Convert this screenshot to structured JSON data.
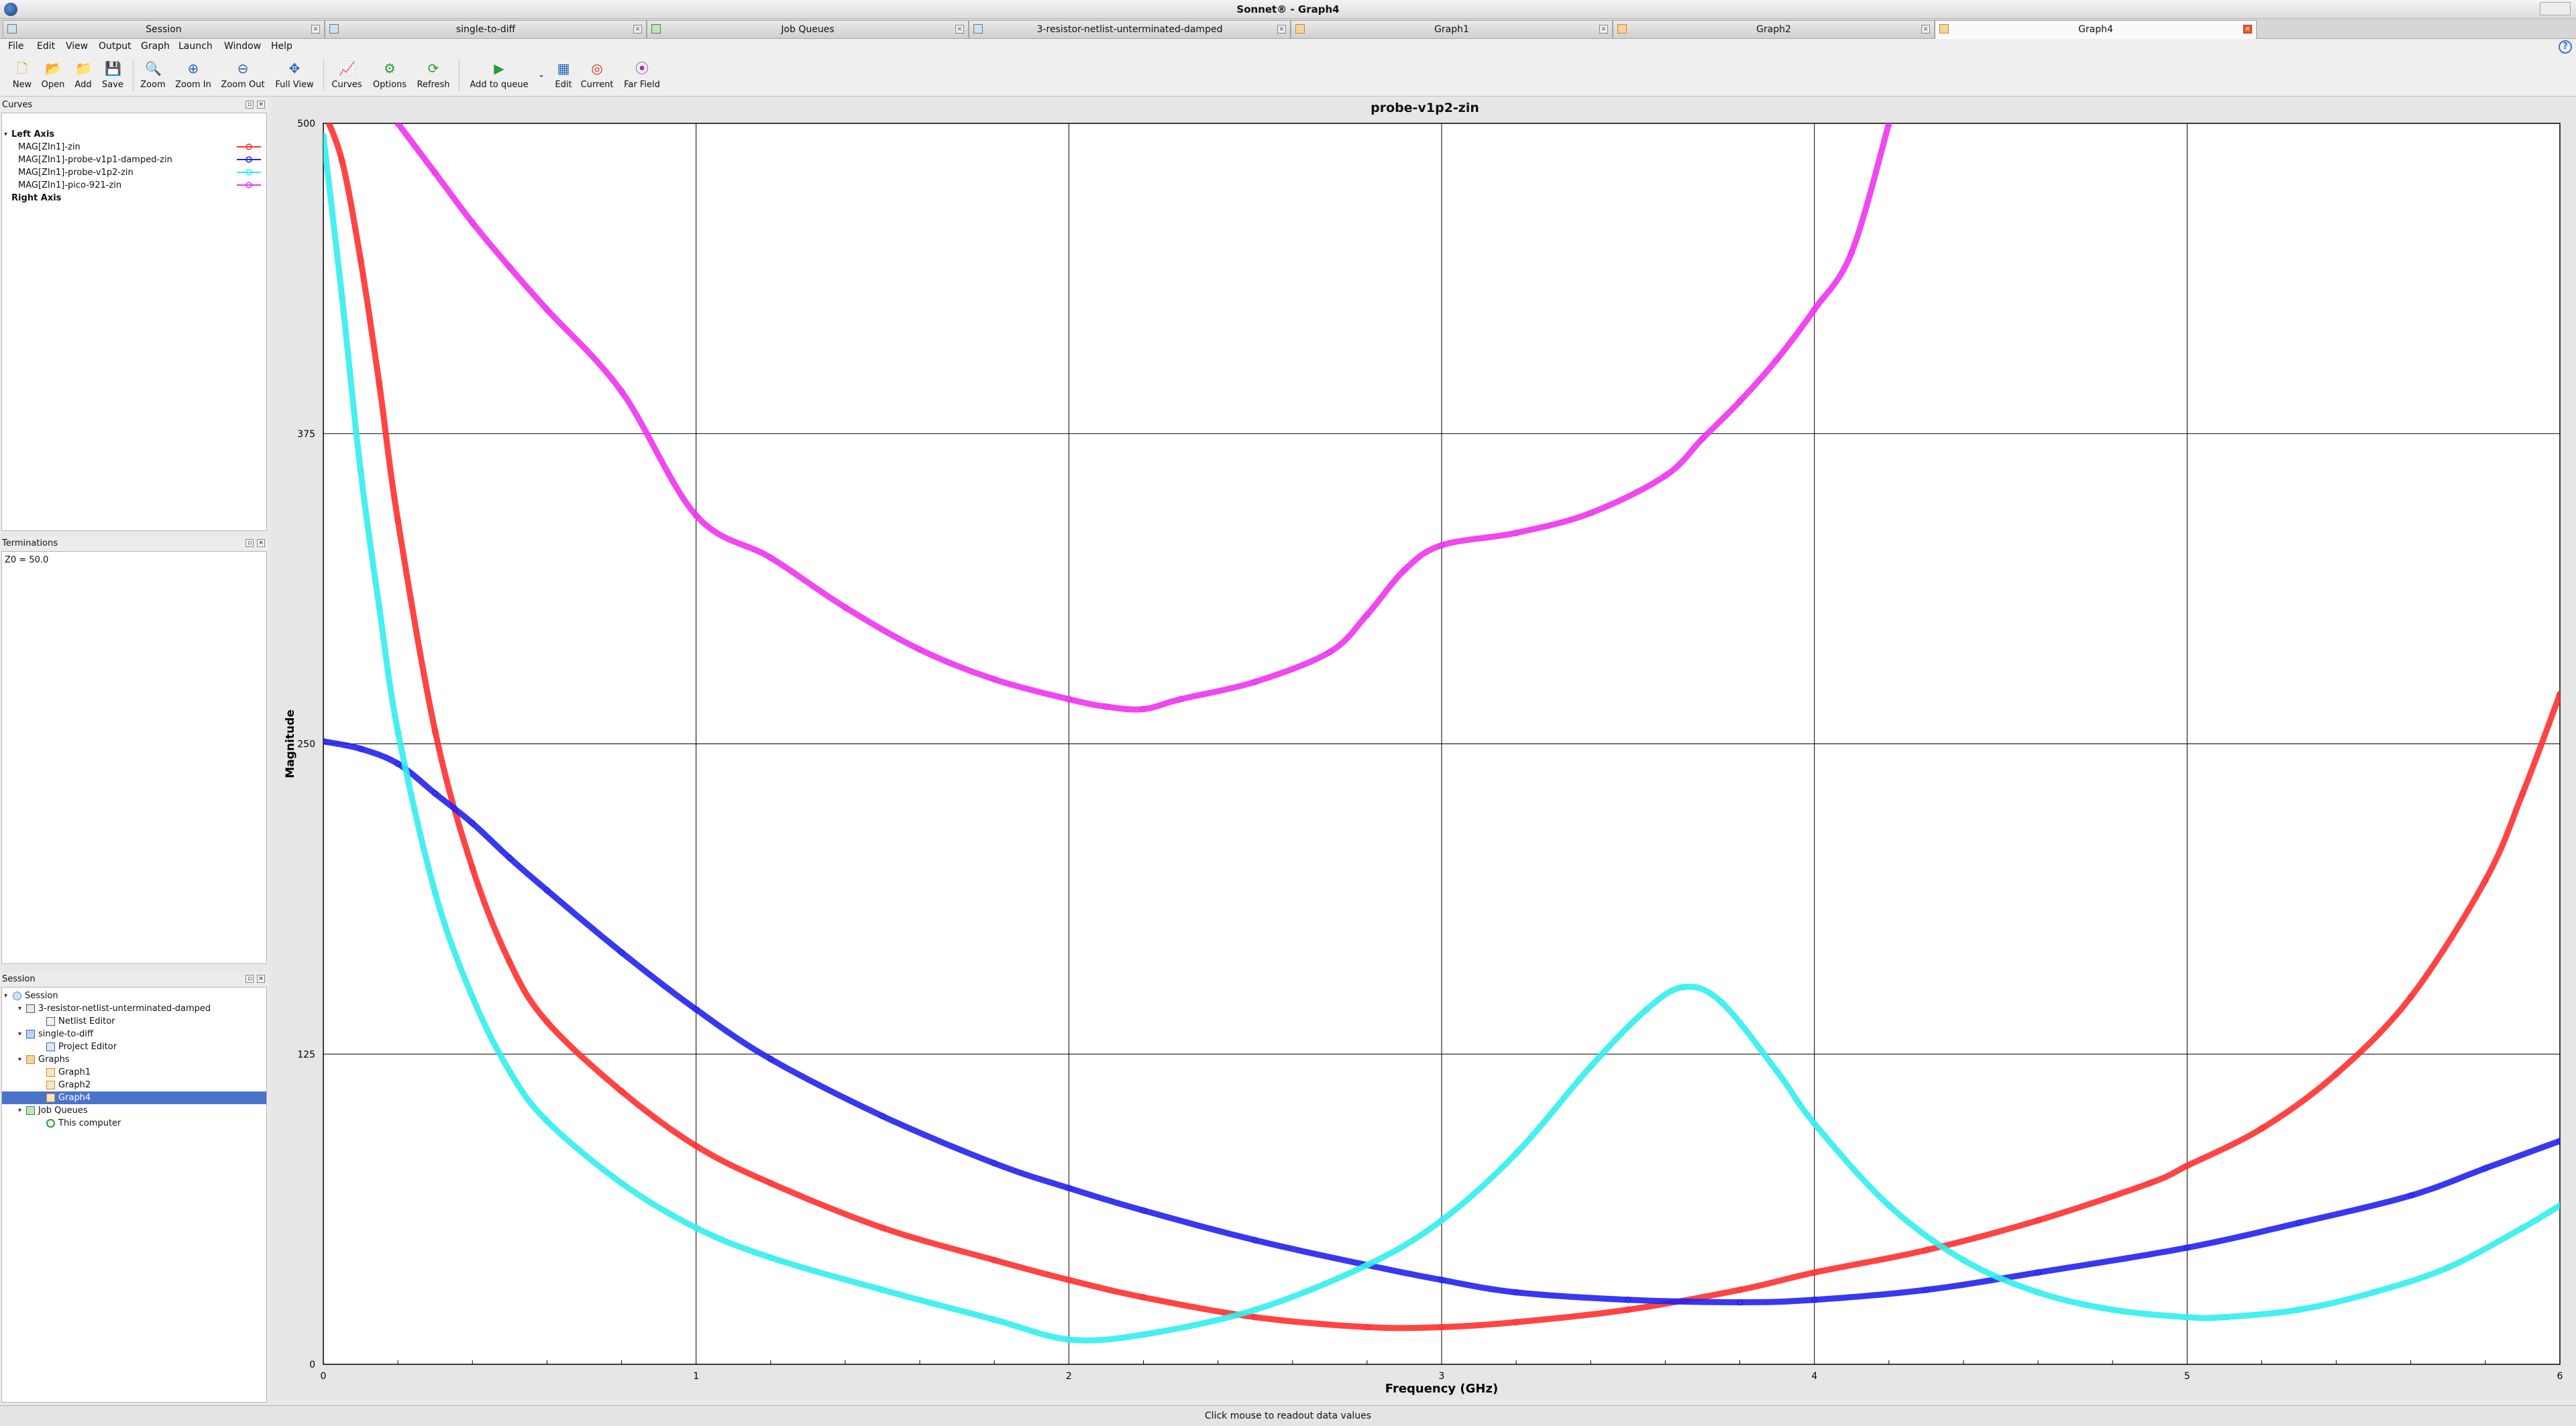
{
  "window": {
    "title": "Sonnet® - Graph4"
  },
  "tabs": [
    {
      "label": "Session",
      "icon": "session-icon"
    },
    {
      "label": "single-to-diff",
      "icon": "project-icon"
    },
    {
      "label": "Job Queues",
      "icon": "job-queue-icon"
    },
    {
      "label": "3-resistor-netlist-unterminated-damped",
      "icon": "netlist-icon"
    },
    {
      "label": "Graph1",
      "icon": "graph-icon"
    },
    {
      "label": "Graph2",
      "icon": "graph-icon"
    },
    {
      "label": "Graph4",
      "icon": "graph-icon",
      "active": true
    }
  ],
  "menu": [
    "File",
    "Edit",
    "View",
    "Output",
    "Graph",
    "Launch",
    "Window",
    "Help"
  ],
  "toolbar": {
    "new": "New",
    "open": "Open",
    "add": "Add",
    "save": "Save",
    "zoom": "Zoom",
    "zoom_in": "Zoom In",
    "zoom_out": "Zoom Out",
    "full_view": "Full View",
    "curves": "Curves",
    "options": "Options",
    "refresh": "Refresh",
    "add_to_queue": "Add to queue",
    "edit": "Edit",
    "current": "Current",
    "far_field": "Far Field"
  },
  "curves_panel": {
    "title": "Curves",
    "left_axis": "Left Axis",
    "right_axis": "Right Axis",
    "items": [
      {
        "label": "MAG[ZIn1]-zin",
        "color": "#ff3030"
      },
      {
        "label": "MAG[ZIn1]-probe-v1p1-damped-zin",
        "color": "#2222ee"
      },
      {
        "label": "MAG[ZIn1]-probe-v1p2-zin",
        "color": "#33eeee"
      },
      {
        "label": "MAG[ZIn1]-pico-921-zin",
        "color": "#ee33ee"
      }
    ]
  },
  "terminations_panel": {
    "title": "Terminations",
    "z0": "Z0 = 50.0"
  },
  "session_panel": {
    "title": "Session",
    "root": "Session",
    "netlist_project": "3-resistor-netlist-unterminated-damped",
    "netlist_editor": "Netlist Editor",
    "geometry_project": "single-to-diff",
    "project_editor": "Project Editor",
    "graphs": "Graphs",
    "graph1": "Graph1",
    "graph2": "Graph2",
    "graph4": "Graph4",
    "job_queues": "Job Queues",
    "this_computer": "This computer"
  },
  "status": "Click mouse to readout data values",
  "chart_data": {
    "type": "line",
    "title": "probe-v1p2-zin",
    "xlabel": "Frequency (GHz)",
    "ylabel": "Magnitude",
    "xlim": [
      0,
      6
    ],
    "ylim": [
      0,
      500
    ],
    "xticks": [
      "0",
      "1",
      "2",
      "3",
      "4",
      "5",
      "6"
    ],
    "yticks": [
      "0",
      "125",
      "250",
      "375",
      "500"
    ],
    "grid": true,
    "series": [
      {
        "name": "MAG[ZIn1]-zin",
        "color": "#ff3030",
        "x": [
          0,
          0.05,
          0.1,
          0.15,
          0.2,
          0.3,
          0.4,
          0.5,
          0.6,
          0.8,
          1.0,
          1.2,
          1.5,
          1.8,
          2.0,
          2.2,
          2.5,
          2.8,
          3.0,
          3.2,
          3.5,
          3.8,
          4.0,
          4.3,
          4.6,
          4.9,
          5.0,
          5.2,
          5.4,
          5.6,
          5.8,
          5.9,
          6.0
        ],
        "y": [
          505,
          485,
          445,
          395,
          340,
          255,
          200,
          162,
          138,
          110,
          88,
          73,
          55,
          42,
          34,
          27,
          19,
          15,
          15,
          17,
          22,
          30,
          37,
          46,
          58,
          73,
          80,
          95,
          117,
          148,
          195,
          230,
          270
        ]
      },
      {
        "name": "MAG[ZIn1]-probe-v1p1-damped-zin",
        "color": "#2222ee",
        "x": [
          0,
          0.1,
          0.2,
          0.3,
          0.4,
          0.5,
          0.6,
          0.8,
          1.0,
          1.2,
          1.5,
          1.8,
          2.0,
          2.2,
          2.5,
          2.8,
          3.0,
          3.2,
          3.5,
          3.8,
          4.0,
          4.3,
          4.6,
          5.0,
          5.3,
          5.6,
          5.8,
          6.0
        ],
        "y": [
          251,
          248,
          242,
          230,
          218,
          204,
          191,
          166,
          143,
          123,
          100,
          81,
          71,
          62,
          50,
          40,
          34,
          29,
          26,
          25,
          26,
          30,
          37,
          47,
          57,
          68,
          79,
          90
        ]
      },
      {
        "name": "MAG[ZIn1]-probe-v1p2-zin",
        "color": "#33eeee",
        "x": [
          0,
          0.05,
          0.1,
          0.15,
          0.2,
          0.3,
          0.4,
          0.5,
          0.6,
          0.8,
          1.0,
          1.2,
          1.5,
          1.8,
          2.0,
          2.2,
          2.5,
          2.8,
          3.0,
          3.2,
          3.4,
          3.55,
          3.65,
          3.75,
          3.9,
          4.0,
          4.2,
          4.4,
          4.6,
          4.8,
          5.0,
          5.1,
          5.3,
          5.5,
          5.7,
          5.9,
          6.0
        ],
        "y": [
          495,
          430,
          360,
          305,
          255,
          190,
          148,
          118,
          98,
          73,
          55,
          43,
          30,
          18,
          10,
          12,
          22,
          40,
          58,
          85,
          120,
          143,
          152,
          146,
          118,
          97,
          64,
          42,
          29,
          22,
          19,
          19,
          22,
          29,
          39,
          55,
          64
        ]
      },
      {
        "name": "MAG[ZIn1]-pico-921-zin",
        "color": "#ee33ee",
        "x": [
          0.2,
          0.3,
          0.4,
          0.5,
          0.6,
          0.8,
          1.0,
          1.2,
          1.4,
          1.6,
          1.8,
          2.0,
          2.1,
          2.2,
          2.3,
          2.5,
          2.7,
          2.8,
          2.9,
          3.0,
          3.2,
          3.4,
          3.6,
          3.7,
          3.8,
          3.9,
          4.0,
          4.1,
          4.2
        ],
        "y": [
          500,
          480,
          460,
          442,
          425,
          392,
          342,
          325,
          305,
          288,
          276,
          268,
          265,
          264,
          268,
          275,
          287,
          302,
          320,
          330,
          335,
          343,
          358,
          373,
          388,
          405,
          425,
          448,
          500
        ]
      }
    ]
  }
}
